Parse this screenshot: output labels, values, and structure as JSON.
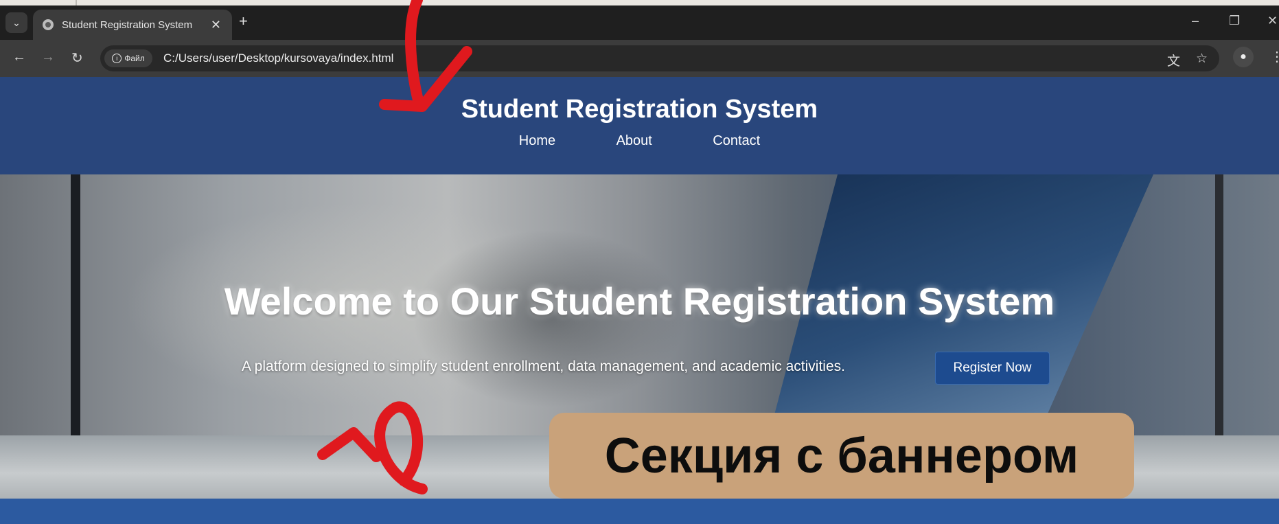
{
  "browser": {
    "tab_title": "Student Registration System",
    "tab_close": "✕",
    "new_tab": "+",
    "tab_search": "⌄",
    "back": "←",
    "forward": "→",
    "reload": "↻",
    "file_chip": "Файл",
    "file_chip_icon": "i",
    "url": "C:/Users/user/Desktop/kursovaya/index.html",
    "translate_icon": "文",
    "bookmark_icon": "☆",
    "profile_icon": "●",
    "menu_icon": "⋮",
    "minimize": "–",
    "restore": "❐",
    "close": "✕"
  },
  "site": {
    "title": "Student Registration System",
    "nav": [
      "Home",
      "About",
      "Contact"
    ]
  },
  "banner": {
    "heading": "Welcome to Our Student Registration System",
    "text": "A platform designed to simplify student enrollment, data management, and academic activities.",
    "button": "Register Now"
  },
  "annotation": {
    "callout": "Секция с баннером",
    "arrow_color": "#e0191e",
    "callout_color": "#c9a27a"
  }
}
